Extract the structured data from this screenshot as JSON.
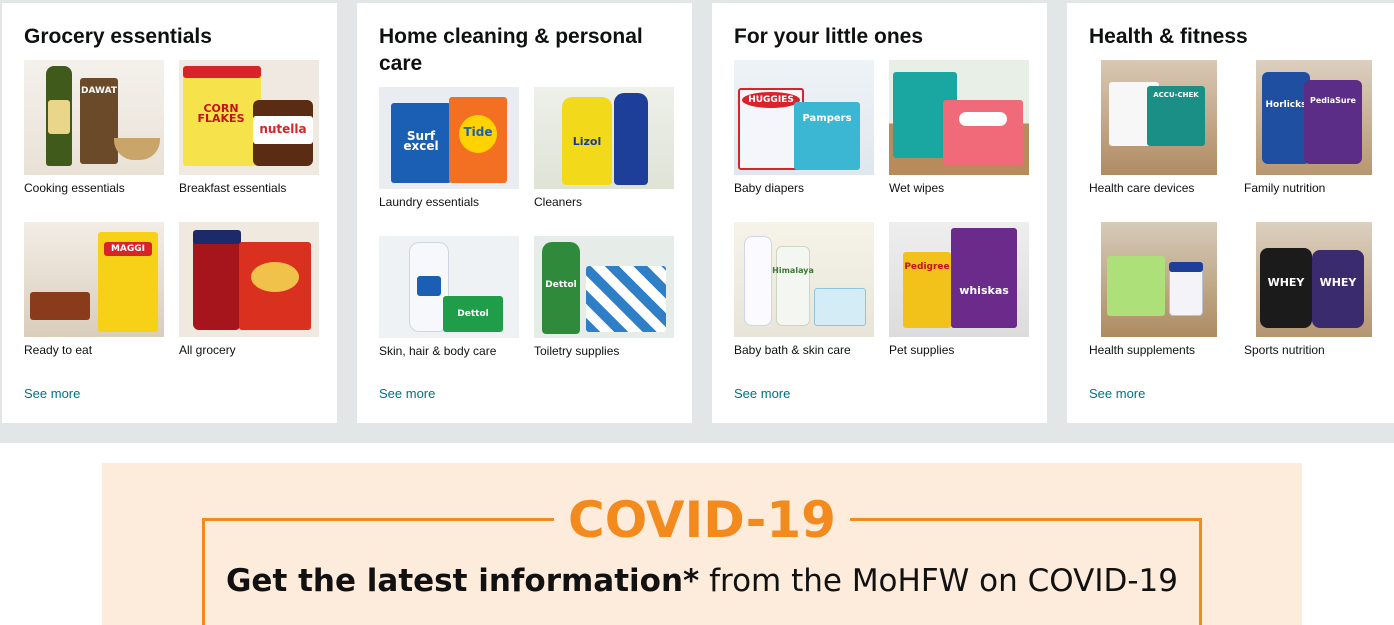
{
  "cards": [
    {
      "title": "Grocery essentials",
      "tiles": [
        {
          "caption": "Cooking essentials"
        },
        {
          "caption": "Breakfast essentials"
        },
        {
          "caption": "Ready to eat"
        },
        {
          "caption": "All grocery"
        }
      ],
      "see_more": "See more"
    },
    {
      "title": "Home cleaning & personal care",
      "tiles": [
        {
          "caption": "Laundry essentials"
        },
        {
          "caption": "Cleaners"
        },
        {
          "caption": "Skin, hair & body care"
        },
        {
          "caption": "Toiletry supplies"
        }
      ],
      "see_more": "See more"
    },
    {
      "title": "For your little ones",
      "tiles": [
        {
          "caption": "Baby diapers"
        },
        {
          "caption": "Wet wipes"
        },
        {
          "caption": "Baby bath & skin care"
        },
        {
          "caption": "Pet supplies"
        }
      ],
      "see_more": "See more"
    },
    {
      "title": "Health & fitness",
      "tiles": [
        {
          "caption": "Health care devices"
        },
        {
          "caption": "Family nutrition"
        },
        {
          "caption": "Health supplements"
        },
        {
          "caption": "Sports nutrition"
        }
      ],
      "see_more": "See more"
    }
  ],
  "product_text": {
    "dawat": "DAWAT",
    "corn_flakes": "CORN FLAKES",
    "nutella": "nutella",
    "maggi": "MAGGI",
    "surf": "Surf excel",
    "tide": "Tide",
    "lizol": "Lizol",
    "dettol": "Dettol",
    "huggies": "HUGGIES",
    "pampers": "Pampers",
    "himalaya": "Himalaya",
    "pedigree": "Pedigree",
    "whiskas": "whiskas",
    "accu_chek": "ACCU-CHEK",
    "horlicks": "Horlicks",
    "pediasure": "PediaSure",
    "whey": "WHEY",
    "whey_2": "WHEY"
  },
  "covid_banner": {
    "title": "COVID-19",
    "subtitle_bold": "Get the latest information*",
    "subtitle_rest": " from the MoHFW on COVID-19"
  },
  "colors": {
    "page_bg": "#e3e6e6",
    "link": "#007185",
    "covid_orange": "#f28a1e",
    "banner_bg": "#fdebdc"
  }
}
